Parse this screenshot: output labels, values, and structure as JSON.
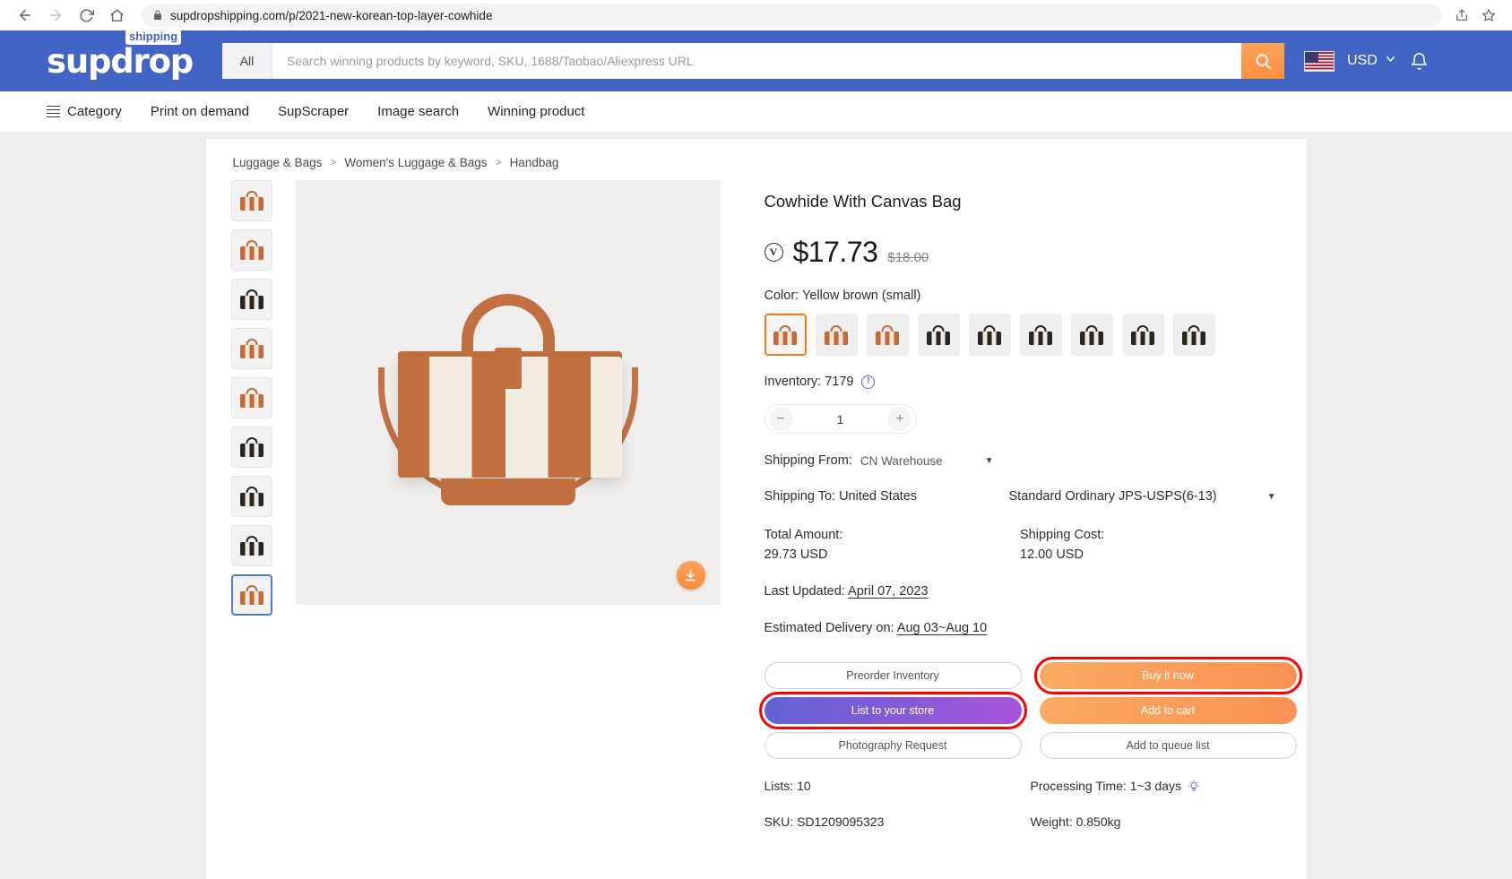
{
  "browser": {
    "url": "supdropshipping.com/p/2021-new-korean-top-layer-cowhide",
    "back_label": "Back",
    "forward_label": "Forward",
    "reload_label": "Reload",
    "home_label": "Home",
    "share_label": "Share",
    "bookmark_label": "Bookmark"
  },
  "header": {
    "logo_text": "supdrop",
    "logo_badge": "shipping",
    "search_category": "All",
    "search_placeholder": "Search winning products by keyword, SKU, 1688/Taobao/Aliexpress URL",
    "search_value": "",
    "currency": "USD",
    "flag": "us-flag",
    "notification_label": "Notifications"
  },
  "nav": {
    "items": [
      {
        "label": "Category",
        "icon": "hamburger-icon"
      },
      {
        "label": "Print on demand",
        "icon": ""
      },
      {
        "label": "SupScraper",
        "icon": ""
      },
      {
        "label": "Image search",
        "icon": ""
      },
      {
        "label": "Winning product",
        "icon": ""
      }
    ]
  },
  "breadcrumb": {
    "items": [
      "Luggage & Bags",
      "Women's Luggage & Bags",
      "Handbag"
    ],
    "separator": ">"
  },
  "gallery": {
    "thumbnails": [
      {
        "name": "thumb-1",
        "tone": "tan",
        "active": false
      },
      {
        "name": "thumb-2",
        "tone": "tan",
        "active": false
      },
      {
        "name": "thumb-3",
        "tone": "black",
        "active": false
      },
      {
        "name": "thumb-4",
        "tone": "tan",
        "active": false
      },
      {
        "name": "thumb-5",
        "tone": "tan",
        "active": false
      },
      {
        "name": "thumb-6",
        "tone": "black",
        "active": false
      },
      {
        "name": "thumb-7",
        "tone": "black",
        "active": false
      },
      {
        "name": "thumb-8",
        "tone": "black",
        "active": false
      },
      {
        "name": "thumb-9",
        "tone": "tan",
        "active": true
      }
    ],
    "download_icon": "download-icon"
  },
  "product": {
    "title": "Cowhide With Canvas Bag",
    "vip_badge": "V",
    "price": "$17.73",
    "original_price": "$18.00",
    "color_label": "Color: Yellow brown (small)",
    "swatches": [
      {
        "tone": "tan",
        "selected": true
      },
      {
        "tone": "tan",
        "selected": false
      },
      {
        "tone": "tan",
        "selected": false
      },
      {
        "tone": "black",
        "selected": false
      },
      {
        "tone": "black",
        "selected": false
      },
      {
        "tone": "black",
        "selected": false
      },
      {
        "tone": "black",
        "selected": false
      },
      {
        "tone": "black",
        "selected": false
      },
      {
        "tone": "black",
        "selected": false
      }
    ],
    "inventory_label": "Inventory: 7179",
    "inventory_info_icon": "info-icon",
    "quantity": "1",
    "minus_label": "−",
    "plus_label": "+",
    "shipping_from_label": "Shipping From:",
    "shipping_from_value": "CN Warehouse",
    "shipping_to_label": "Shipping To: United States",
    "shipping_method": "Standard Ordinary JPS-USPS(6-13)",
    "total_amount_label": "Total Amount:",
    "total_amount_value": "29.73 USD",
    "shipping_cost_label": "Shipping Cost:",
    "shipping_cost_value": "12.00 USD",
    "last_updated_label": "Last Updated:",
    "last_updated_value": "April 07, 2023",
    "estimated_delivery_label": "Estimated Delivery on:",
    "estimated_delivery_value": "Aug 03~Aug 10",
    "buttons": {
      "preorder": "Preorder Inventory",
      "buy_now": "Buy it now",
      "list_store": "List to your store",
      "add_cart": "Add to cart",
      "photography": "Photography Request",
      "queue": "Add to queue list"
    },
    "highlighted_buttons": [
      "Buy it now",
      "List to your store"
    ],
    "meta": {
      "lists": "Lists: 10",
      "processing_time": "Processing Time: 1~3 days",
      "processing_icon": "bulb-icon",
      "sku": "SKU: SD1209095323",
      "weight": "Weight: 0.850kg"
    }
  },
  "colors": {
    "brand_blue": "#4264c4",
    "accent_orange": "#f78c37",
    "highlight_red": "#ff0000",
    "purple_gradient_start": "#6163d4",
    "purple_gradient_end": "#a754d8"
  }
}
